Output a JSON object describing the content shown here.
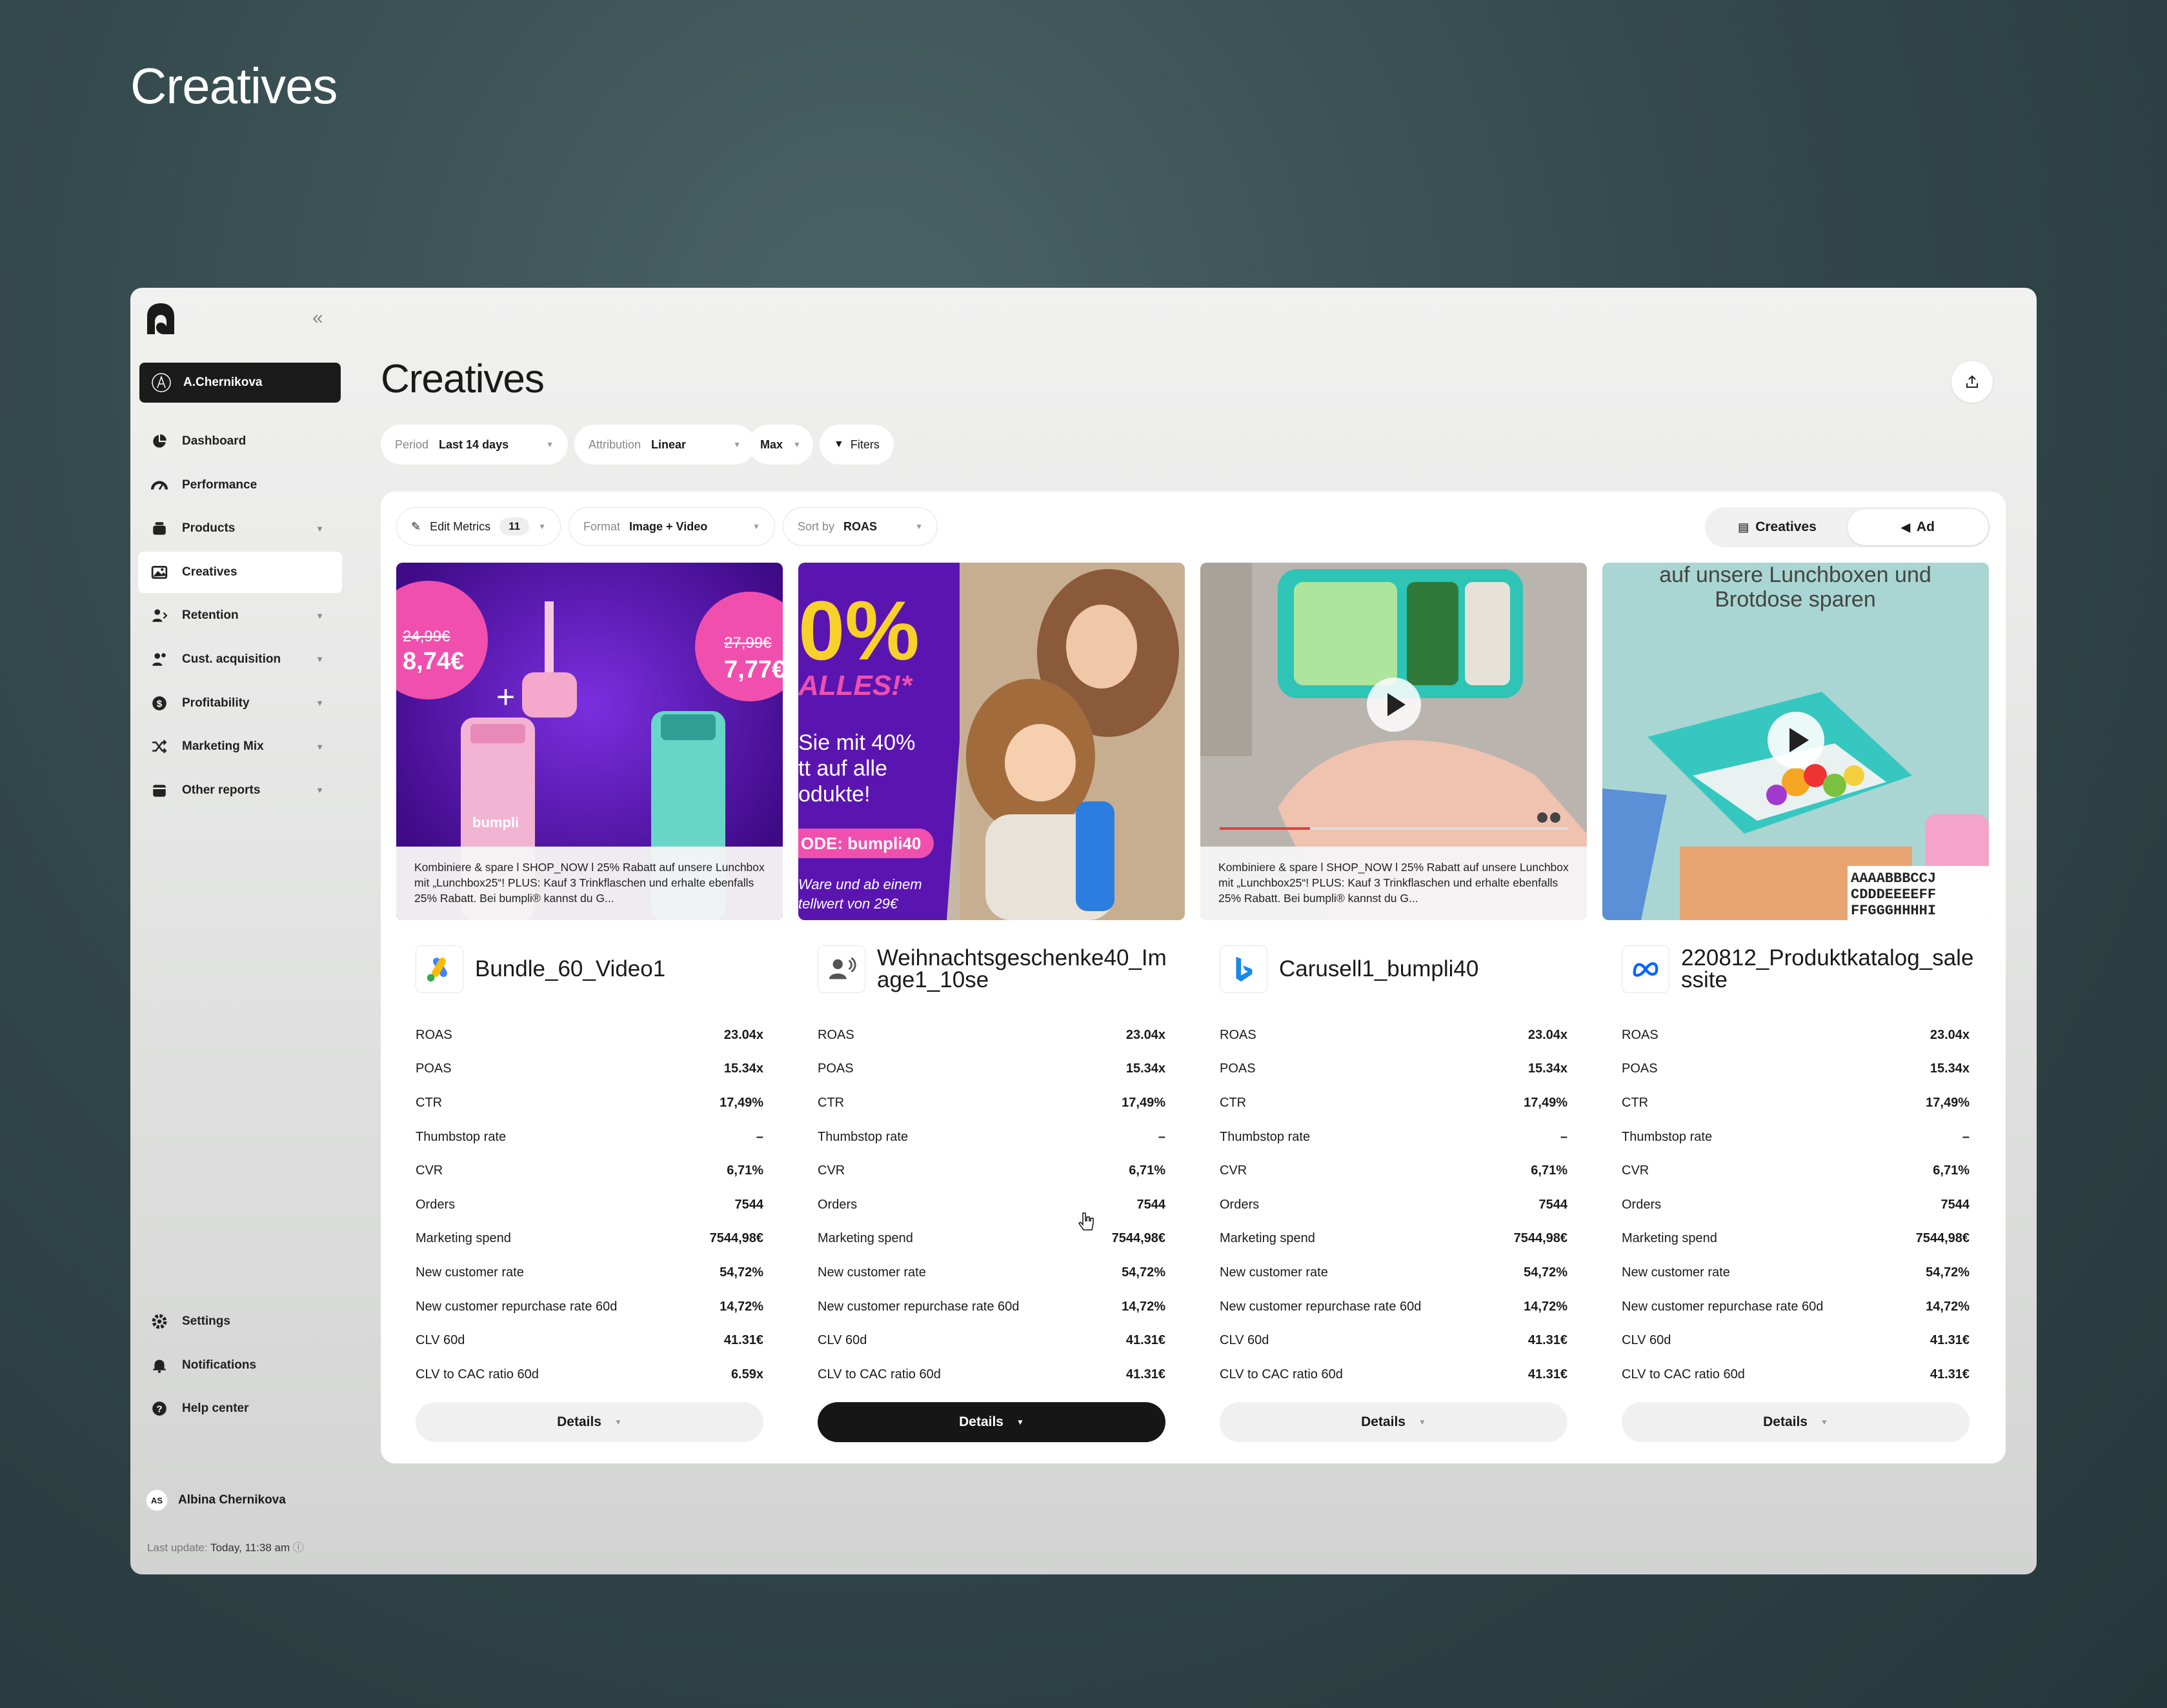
{
  "outer_title": "Creatives",
  "sidebar": {
    "user": "A.Chernikova",
    "items": [
      {
        "label": "Dashboard",
        "icon": "pie-chart-icon",
        "chevron": false
      },
      {
        "label": "Performance",
        "icon": "gauge-icon",
        "chevron": false
      },
      {
        "label": "Products",
        "icon": "basket-icon",
        "chevron": true
      },
      {
        "label": "Creatives",
        "icon": "image-icon",
        "chevron": false,
        "active": true
      },
      {
        "label": "Retention",
        "icon": "users-icon",
        "chevron": true
      },
      {
        "label": "Cust. acquisition",
        "icon": "user-add-icon",
        "chevron": true
      },
      {
        "label": "Profitability",
        "icon": "coin-icon",
        "chevron": true
      },
      {
        "label": "Marketing Mix",
        "icon": "shuffle-icon",
        "chevron": true
      },
      {
        "label": "Other reports",
        "icon": "folder-icon",
        "chevron": true
      }
    ],
    "bottom_items": [
      {
        "label": "Settings",
        "icon": "gear-icon"
      },
      {
        "label": "Notifications",
        "icon": "bell-icon"
      },
      {
        "label": "Help center",
        "icon": "help-icon"
      }
    ],
    "profile": {
      "initials": "AS",
      "name": "Albina Chernikova"
    },
    "last_update_label": "Last update:",
    "last_update_value": "Today, 11:38 am"
  },
  "main": {
    "title": "Creatives",
    "filters": {
      "period_label": "Period",
      "period_value": "Last 14 days",
      "attribution_label": "Attribution",
      "attribution_value": "Linear",
      "max_value": "Max",
      "filters_label": "Fiters"
    },
    "toolbar": {
      "edit_metrics": "Edit Metrics",
      "metrics_count": "11",
      "format_label": "Format",
      "format_value": "Image + Video",
      "sort_label": "Sort by",
      "sort_value": "ROAS"
    },
    "view_toggle": {
      "creatives": "Creatives",
      "ad": "Ad"
    }
  },
  "metric_labels": [
    "ROAS",
    "POAS",
    "CTR",
    "Thumbstop rate",
    "CVR",
    "Orders",
    "Marketing spend",
    "New customer rate",
    "New customer repurchase rate 60d",
    "CLV 60d",
    "CLV to CAC ratio 60d"
  ],
  "cards": [
    {
      "name": "Bundle_60_Video1",
      "platform": "google-ads-icon",
      "caption": "Kombiniere & spare l SHOP_NOW l 25% Rabatt auf unsere Lunchbox mit „Lunchbox25“! PLUS: Kauf 3 Trinkflaschen und erhalte ebenfalls 25% Rabatt. Bei bumpli® kannst du G...",
      "thumb_text": {
        "old1": "24,99€",
        "new1": "8,74€",
        "old2": "27,99€",
        "new2": "7,77€",
        "brand": "bumpli"
      },
      "values": [
        "23.04x",
        "15.34x",
        "17,49%",
        "–",
        "6,71%",
        "7544",
        "7544,98€",
        "54,72%",
        "14,72%",
        "41.31€",
        "6.59x"
      ],
      "details": "Details",
      "highlight": false
    },
    {
      "name": "Weihnachtsgeschenke40_Image1_10se",
      "platform": "audience-icon",
      "caption": "",
      "thumb_text": {
        "big": "0%",
        "alles": "ALLES!*",
        "line1": "Sie mit 40%",
        "line2": "tt auf alle",
        "line3": "odukte!",
        "code": "ODE: bumpli40",
        "foot1": "Ware und ab einem",
        "foot2": "tellwert von 29€",
        "brand": "bumpli"
      },
      "values": [
        "23.04x",
        "15.34x",
        "17,49%",
        "–",
        "6,71%",
        "7544",
        "7544,98€",
        "54,72%",
        "14,72%",
        "41.31€",
        "41.31€"
      ],
      "details": "Details",
      "highlight": true
    },
    {
      "name": "Carusell1_bumpli40",
      "platform": "bing-icon",
      "caption": "Kombiniere & spare l SHOP_NOW l 25% Rabatt auf unsere Lunchbox mit „Lunchbox25“! PLUS: Kauf 3 Trinkflaschen und erhalte ebenfalls 25% Rabatt. Bei bumpli® kannst du G...",
      "thumb_text": {},
      "values": [
        "23.04x",
        "15.34x",
        "17,49%",
        "–",
        "6,71%",
        "7544",
        "7544,98€",
        "54,72%",
        "14,72%",
        "41.31€",
        "41.31€"
      ],
      "details": "Details",
      "highlight": false
    },
    {
      "name": "220812_Produktkatalog_salessite",
      "platform": "meta-icon",
      "caption": "",
      "thumb_text": {
        "line1": "auf unsere Lunchboxen und",
        "line2": "Brotdose sparen",
        "letters1": "AAAABBBCCJ",
        "letters2": "CDDDEEEEFF",
        "letters3": "FFGGGHHHHI"
      },
      "values": [
        "23.04x",
        "15.34x",
        "17,49%",
        "–",
        "6,71%",
        "7544",
        "7544,98€",
        "54,72%",
        "14,72%",
        "41.31€",
        "41.31€"
      ],
      "details": "Details",
      "highlight": false
    }
  ],
  "colors": {
    "accent_dark": "#161616",
    "purple": "#5b1ab5",
    "pink": "#f04fae",
    "teal": "#3fc6bd"
  }
}
